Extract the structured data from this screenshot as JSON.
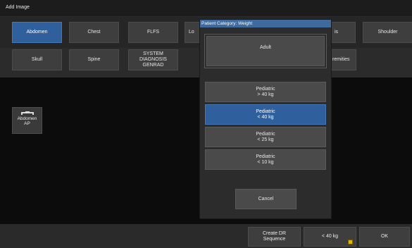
{
  "window": {
    "title": "Add Image"
  },
  "categories_row1": [
    {
      "label": "Abdomen",
      "active": true
    },
    {
      "label": "Chest",
      "active": false
    },
    {
      "label": "FLFS",
      "active": false
    },
    {
      "label": "Lo",
      "active": false
    },
    {
      "label": "is",
      "active": false
    },
    {
      "label": "Shoulder",
      "active": false
    }
  ],
  "categories_row2": [
    {
      "label": "Skull"
    },
    {
      "label": "Spine"
    },
    {
      "label": "SYSTEM\nDIAGNOSIS\nGENRAD"
    },
    {
      "label": "remities"
    }
  ],
  "selected_view": {
    "icon": "table-icon",
    "label": "Abdomen\nAP"
  },
  "dialog": {
    "title": "Patient Category: Weight",
    "adult_label": "Adult",
    "options": [
      {
        "label": "Pediatric\n> 40 kg",
        "selected": false
      },
      {
        "label": "Pediatric\n< 40 kg",
        "selected": true
      },
      {
        "label": "Pediatric\n< 25 kg",
        "selected": false
      },
      {
        "label": "Pediatric\n< 10 kg",
        "selected": false
      }
    ],
    "cancel_label": "Cancel"
  },
  "bottom": {
    "create_dr_label": "Create DR\nSequence",
    "weight_label": "< 40 kg",
    "ok_label": "OK",
    "warning_icon": "warning-icon"
  },
  "colors": {
    "accent": "#2f5f9c",
    "dialog_title": "#3f6a9e",
    "button": "#3e3e3e",
    "background": "#0c0c0c"
  }
}
